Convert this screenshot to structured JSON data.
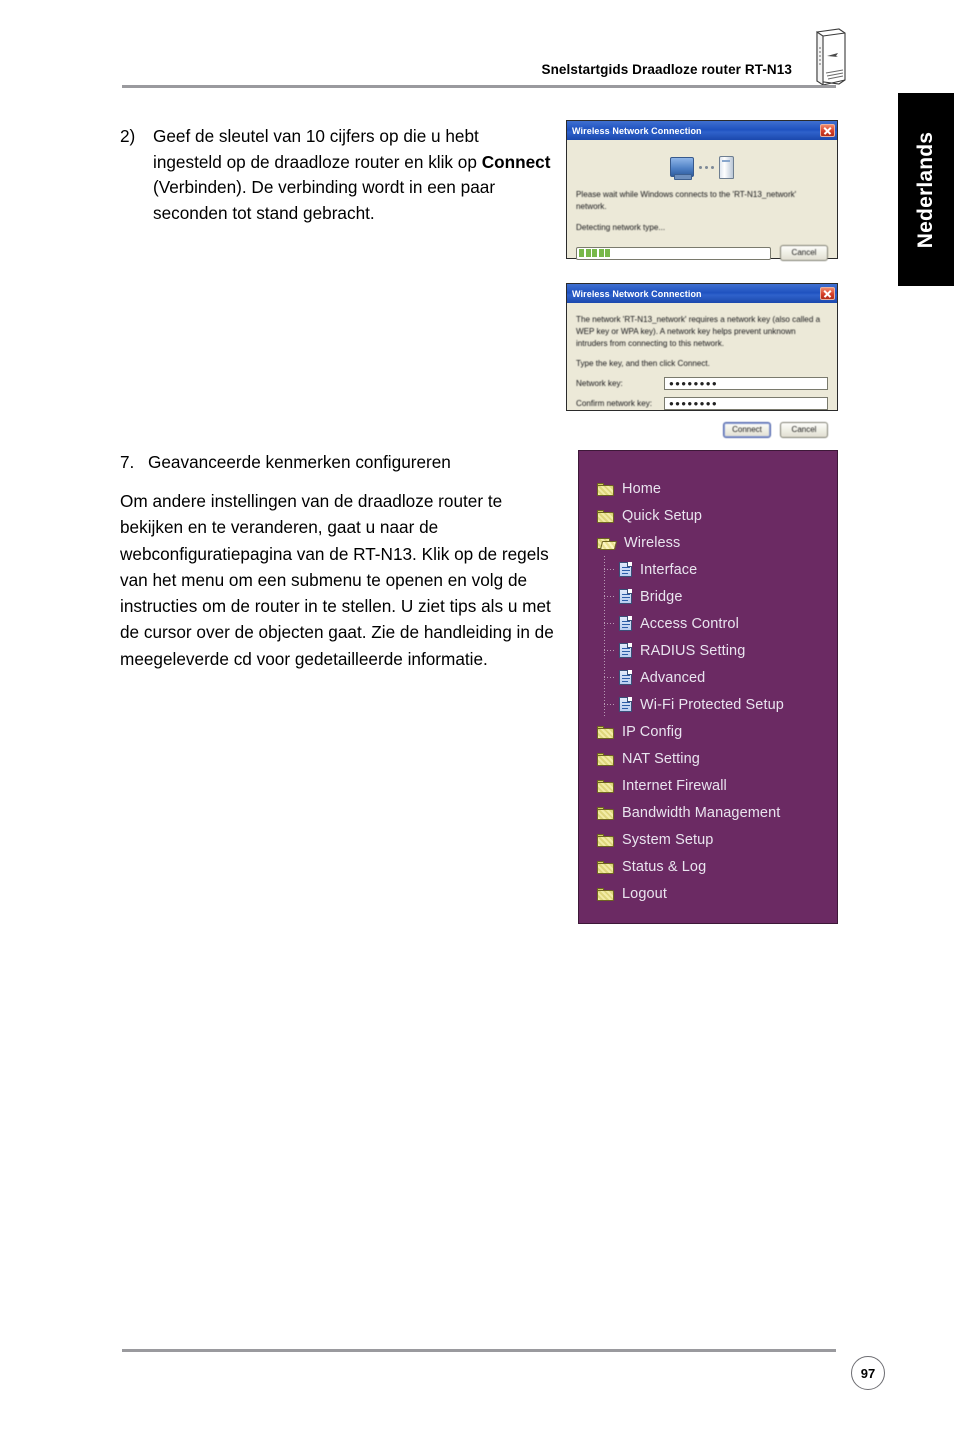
{
  "header": {
    "title": "Snelstartgids Draadloze router RT-N13",
    "router_icon": "router-device-icon"
  },
  "language_tab": {
    "label": "Nederlands"
  },
  "content": {
    "step2": {
      "number": "2)",
      "text_before_bold": "Geef de sleutel van 10 cijfers op die u hebt ingesteld op de draadloze router en klik op ",
      "bold": "Connect",
      "text_after_bold": " (Verbinden). De verbinding wordt in een paar seconden tot stand gebracht."
    },
    "section7": {
      "number": "7.",
      "title": "Geavanceerde kenmerken configureren",
      "body": "Om andere instellingen van de draadloze router te bekijken en te veranderen, gaat u naar de webconfiguratiepagina van de RT-N13. Klik op de regels van het menu om een submenu te openen en volg de instructies om de router in te stellen. U ziet tips als u met de cursor over de objecten gaat. Zie de handleiding in de meegeleverde cd voor gedetailleerde informatie."
    }
  },
  "dialog_connecting": {
    "title": "Wireless Network Connection",
    "close_icon": "close-icon",
    "message": "Please wait while Windows connects to the 'RT-N13_network' network.",
    "status": "Detecting network type...",
    "cancel_label": "Cancel",
    "progress_blocks": 5
  },
  "dialog_wepkey": {
    "title": "Wireless Network Connection",
    "close_icon": "close-icon",
    "message": "The network 'RT-N13_network' requires a network key (also called a WEP key or WPA key). A network key helps prevent unknown intruders from connecting to this network.",
    "instruction": "Type the key, and then click Connect.",
    "network_key_label": "Network key:",
    "network_key_value": "●●●●●●●●",
    "confirm_key_label": "Confirm network key:",
    "confirm_key_value": "●●●●●●●●",
    "connect_label": "Connect",
    "cancel_label": "Cancel"
  },
  "router_menu": {
    "background_color": "#6b2a63",
    "items": [
      {
        "label": "Home",
        "icon": "closed-folder-icon",
        "level": 0
      },
      {
        "label": "Quick Setup",
        "icon": "closed-folder-icon",
        "level": 0
      },
      {
        "label": "Wireless",
        "icon": "open-folder-icon",
        "level": 0
      },
      {
        "label": "Interface",
        "icon": "page-icon",
        "level": 1
      },
      {
        "label": "Bridge",
        "icon": "page-icon",
        "level": 1
      },
      {
        "label": "Access Control",
        "icon": "page-icon",
        "level": 1
      },
      {
        "label": "RADIUS Setting",
        "icon": "page-icon",
        "level": 1
      },
      {
        "label": "Advanced",
        "icon": "page-icon",
        "level": 1
      },
      {
        "label": "Wi-Fi Protected Setup",
        "icon": "page-icon",
        "level": 1
      },
      {
        "label": "IP Config",
        "icon": "closed-folder-icon",
        "level": 0
      },
      {
        "label": "NAT Setting",
        "icon": "closed-folder-icon",
        "level": 0
      },
      {
        "label": "Internet Firewall",
        "icon": "closed-folder-icon",
        "level": 0
      },
      {
        "label": "Bandwidth Management",
        "icon": "closed-folder-icon",
        "level": 0
      },
      {
        "label": "System Setup",
        "icon": "closed-folder-icon",
        "level": 0
      },
      {
        "label": "Status & Log",
        "icon": "closed-folder-icon",
        "level": 0
      },
      {
        "label": "Logout",
        "icon": "closed-folder-icon",
        "level": 0
      }
    ]
  },
  "footer": {
    "page_number": "97"
  }
}
